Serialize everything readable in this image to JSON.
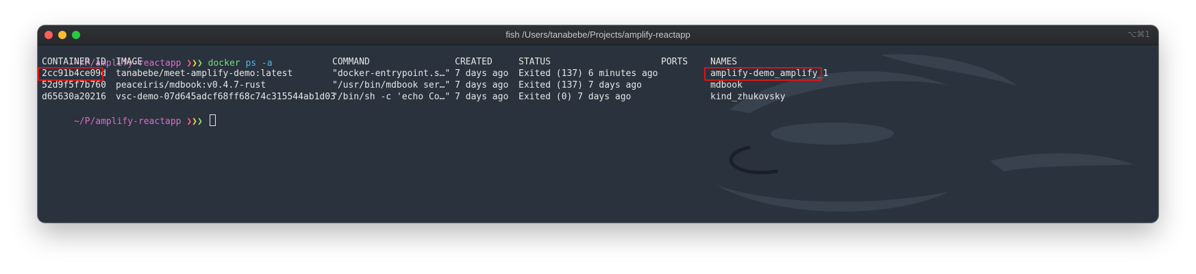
{
  "window": {
    "title": "fish /Users/tanabebe/Projects/amplify-reactapp",
    "shortcut": "⌥⌘1"
  },
  "prompt": {
    "path": "~/P/amplify-reactapp",
    "arrows": [
      "❯",
      "❯",
      "❯"
    ],
    "command": "docker",
    "args": "ps -a"
  },
  "table": {
    "headers": [
      "CONTAINER ID",
      "IMAGE",
      "COMMAND",
      "CREATED",
      "STATUS",
      "PORTS",
      "NAMES"
    ],
    "rows": [
      [
        "2cc91b4ce09d",
        "tanabebe/meet-amplify-demo:latest",
        "\"docker-entrypoint.s…\"",
        "7 days ago",
        "Exited (137) 6 minutes ago",
        "",
        "amplify-demo_amplify_1"
      ],
      [
        "52d9f5f7b760",
        "peaceiris/mdbook:v0.4.7-rust",
        "\"/usr/bin/mdbook ser…\"",
        "7 days ago",
        "Exited (137) 7 days ago",
        "",
        "mdbook"
      ],
      [
        "d65630a20216",
        "vsc-demo-07d645adcf68ff68c74c315544ab1d03",
        "\"/bin/sh -c 'echo Co…\"",
        "7 days ago",
        "Exited (0) 7 days ago",
        "",
        "kind_zhukovsky"
      ]
    ]
  },
  "colors": {
    "terminal_bg": "#2a323d",
    "highlight_box": "#e01414",
    "prompt_path": "#d96ec8",
    "command": "#6fe07c"
  }
}
